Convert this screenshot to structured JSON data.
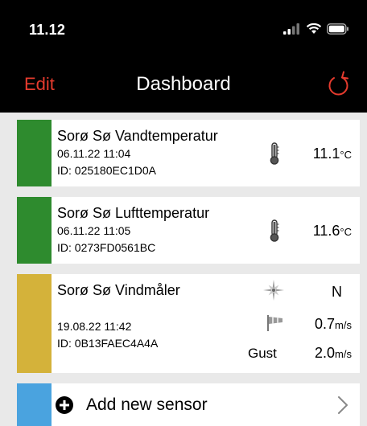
{
  "status": {
    "time": "11.12"
  },
  "nav": {
    "edit_label": "Edit",
    "title": "Dashboard",
    "refresh_icon": "refresh-icon"
  },
  "colors": {
    "accent": "#e63b2e",
    "green": "#2e8b2e",
    "yellow": "#d4b23a",
    "blue": "#4aa3df"
  },
  "sensors": [
    {
      "name": "Sorø Sø Vandtemperatur",
      "date": "06.11.22  11:04",
      "id": "ID: 025180EC1D0A",
      "value": "11.1",
      "unit": "°C",
      "status_color": "#2e8b2e",
      "icon": "thermometer-icon"
    },
    {
      "name": "Sorø Sø Lufttemperatur",
      "date": "06.11.22  11:05",
      "id": "ID: 0273FD0561BC",
      "value": "11.6",
      "unit": "°C",
      "status_color": "#2e8b2e",
      "icon": "thermometer-icon"
    },
    {
      "name": "Sorø Sø Vindmåler",
      "date": "19.08.22  11:42",
      "id": "ID: 0B13FAEC4A4A",
      "direction": "N",
      "speed_value": "0.7",
      "speed_unit": "m/s",
      "gust_label": "Gust",
      "gust_value": "2.0",
      "gust_unit": "m/s",
      "status_color": "#d4b23a",
      "icons": [
        "compass-icon",
        "windsock-icon"
      ]
    }
  ],
  "add_sensor": {
    "label": "Add new sensor",
    "icon": "plus-circle-icon",
    "chevron": "chevron-right-icon"
  }
}
